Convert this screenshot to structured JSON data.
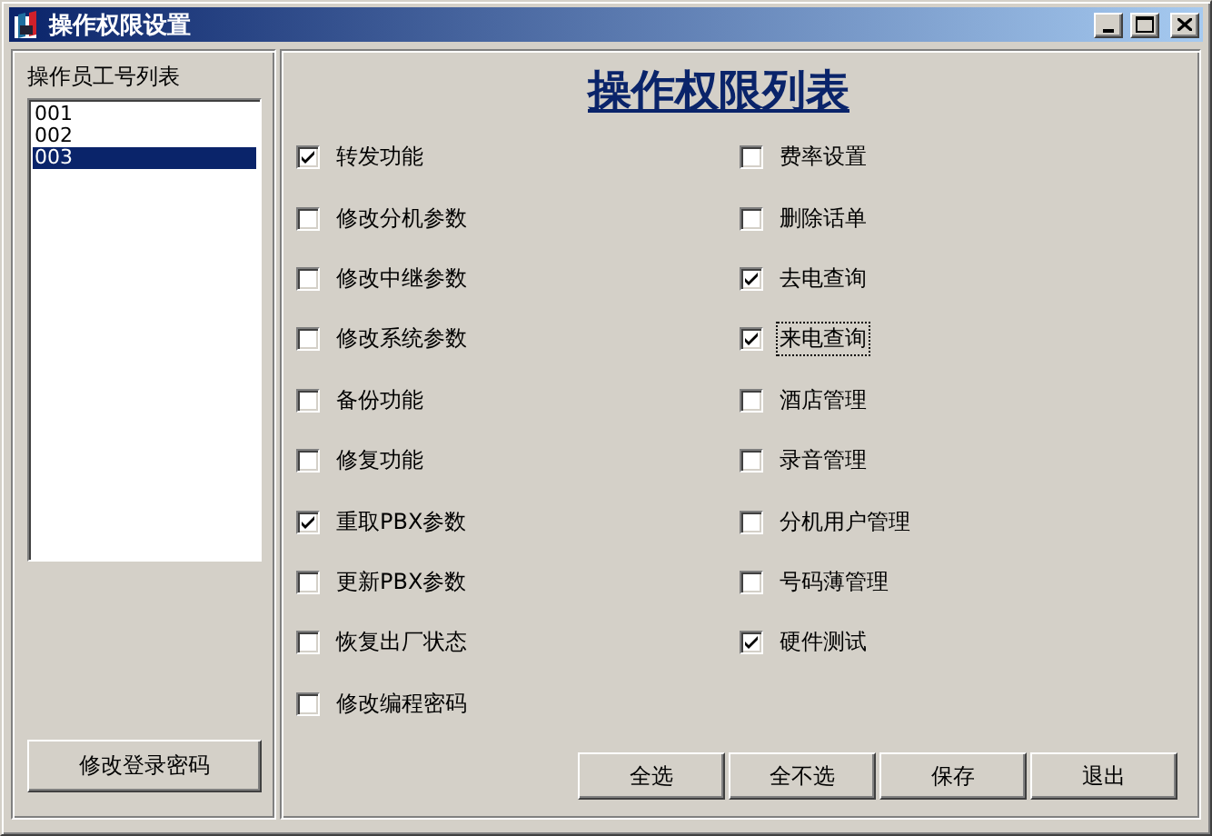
{
  "window": {
    "title": "操作权限设置"
  },
  "operators": {
    "label": "操作员工号列表",
    "items": [
      {
        "text": "001",
        "selected": false
      },
      {
        "text": "002",
        "selected": false
      },
      {
        "text": "003",
        "selected": true
      }
    ],
    "button": "修改登录密码"
  },
  "permissions": {
    "title": "操作权限列表",
    "columns": [
      [
        {
          "label": "转发功能",
          "checked": true,
          "focused": false
        },
        {
          "label": "修改分机参数",
          "checked": false,
          "focused": false
        },
        {
          "label": "修改中继参数",
          "checked": false,
          "focused": false
        },
        {
          "label": "修改系统参数",
          "checked": false,
          "focused": false
        },
        {
          "label": "备份功能",
          "checked": false,
          "focused": false
        },
        {
          "label": "修复功能",
          "checked": false,
          "focused": false
        },
        {
          "label": "重取PBX参数",
          "checked": true,
          "focused": false
        },
        {
          "label": "更新PBX参数",
          "checked": false,
          "focused": false
        },
        {
          "label": "恢复出厂状态",
          "checked": false,
          "focused": false
        },
        {
          "label": "修改编程密码",
          "checked": false,
          "focused": false
        }
      ],
      [
        {
          "label": "费率设置",
          "checked": false,
          "focused": false
        },
        {
          "label": "删除话单",
          "checked": false,
          "focused": false
        },
        {
          "label": "去电查询",
          "checked": true,
          "focused": false
        },
        {
          "label": "来电查询",
          "checked": true,
          "focused": true
        },
        {
          "label": "酒店管理",
          "checked": false,
          "focused": false
        },
        {
          "label": "录音管理",
          "checked": false,
          "focused": false
        },
        {
          "label": "分机用户管理",
          "checked": false,
          "focused": false
        },
        {
          "label": "号码薄管理",
          "checked": false,
          "focused": false
        },
        {
          "label": "硬件测试",
          "checked": true,
          "focused": false
        }
      ]
    ]
  },
  "buttons": [
    "全选",
    "全不选",
    "保存",
    "退出"
  ]
}
